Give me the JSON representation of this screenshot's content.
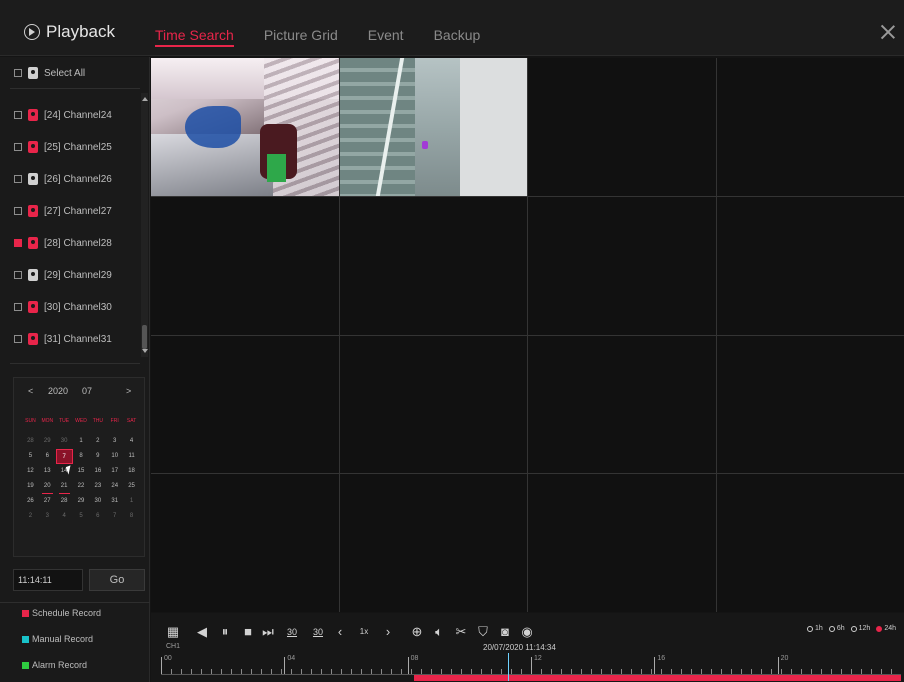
{
  "header": {
    "title": "Playback",
    "tabs": [
      {
        "label": "Time Search",
        "active": true
      },
      {
        "label": "Picture Grid",
        "active": false
      },
      {
        "label": "Event",
        "active": false
      },
      {
        "label": "Backup",
        "active": false
      }
    ]
  },
  "sidebar": {
    "select_all_label": "Select All",
    "channels": [
      {
        "label": "[24] Channel24",
        "checked": false,
        "cam_color": "red"
      },
      {
        "label": "[25] Channel25",
        "checked": false,
        "cam_color": "red"
      },
      {
        "label": "[26] Channel26",
        "checked": false,
        "cam_color": "white"
      },
      {
        "label": "[27] Channel27",
        "checked": false,
        "cam_color": "red"
      },
      {
        "label": "[28] Channel28",
        "checked": true,
        "cam_color": "red"
      },
      {
        "label": "[29] Channel29",
        "checked": false,
        "cam_color": "white"
      },
      {
        "label": "[30] Channel30",
        "checked": false,
        "cam_color": "red"
      },
      {
        "label": "[31] Channel31",
        "checked": false,
        "cam_color": "red"
      }
    ]
  },
  "calendar": {
    "prev": "<",
    "next": ">",
    "year": "2020",
    "month": "07",
    "weekdays": [
      "SUN",
      "MON",
      "TUE",
      "WED",
      "THU",
      "FRI",
      "SAT"
    ],
    "days": [
      {
        "d": "28",
        "muted": true
      },
      {
        "d": "29",
        "muted": true
      },
      {
        "d": "30",
        "muted": true
      },
      {
        "d": "1"
      },
      {
        "d": "2"
      },
      {
        "d": "3"
      },
      {
        "d": "4"
      },
      {
        "d": "5"
      },
      {
        "d": "6"
      },
      {
        "d": "7",
        "selected": true
      },
      {
        "d": "8"
      },
      {
        "d": "9"
      },
      {
        "d": "10"
      },
      {
        "d": "11"
      },
      {
        "d": "12"
      },
      {
        "d": "13"
      },
      {
        "d": "14"
      },
      {
        "d": "15"
      },
      {
        "d": "16"
      },
      {
        "d": "17"
      },
      {
        "d": "18"
      },
      {
        "d": "19"
      },
      {
        "d": "20",
        "rec": true
      },
      {
        "d": "21",
        "rec": true
      },
      {
        "d": "22"
      },
      {
        "d": "23"
      },
      {
        "d": "24"
      },
      {
        "d": "25"
      },
      {
        "d": "26"
      },
      {
        "d": "27"
      },
      {
        "d": "28"
      },
      {
        "d": "29"
      },
      {
        "d": "30"
      },
      {
        "d": "31"
      },
      {
        "d": "1",
        "muted": true
      },
      {
        "d": "2",
        "muted": true
      },
      {
        "d": "3",
        "muted": true
      },
      {
        "d": "4",
        "muted": true
      },
      {
        "d": "5",
        "muted": true
      },
      {
        "d": "6",
        "muted": true
      },
      {
        "d": "7",
        "muted": true
      },
      {
        "d": "8",
        "muted": true
      }
    ]
  },
  "time_search": {
    "time_value": "11:14:11",
    "go_label": "Go"
  },
  "legend": [
    {
      "label": "Schedule Record",
      "color": "#e8254a"
    },
    {
      "label": "Manual Record",
      "color": "#19c2c9"
    },
    {
      "label": "Alarm Record",
      "color": "#2ecc40"
    }
  ],
  "toolbar": {
    "channel_label": "CH1",
    "speed_label": "1x",
    "skip_back_label": "30",
    "skip_fwd_label": "30",
    "timestamp": "20/07/2020 11:14:34",
    "zoom_options": [
      {
        "label": "1h",
        "on": false
      },
      {
        "label": "6h",
        "on": false
      },
      {
        "label": "12h",
        "on": false
      },
      {
        "label": "24h",
        "on": true
      }
    ]
  },
  "timeline": {
    "labels": [
      "00",
      "04",
      "08",
      "12",
      "16",
      "20"
    ],
    "record_start_hour": 8.2,
    "record_end_hour": 24,
    "cursor_hour": 11.24
  },
  "colors": {
    "accent": "#e8254a",
    "selected_cell": "#c2185b"
  }
}
